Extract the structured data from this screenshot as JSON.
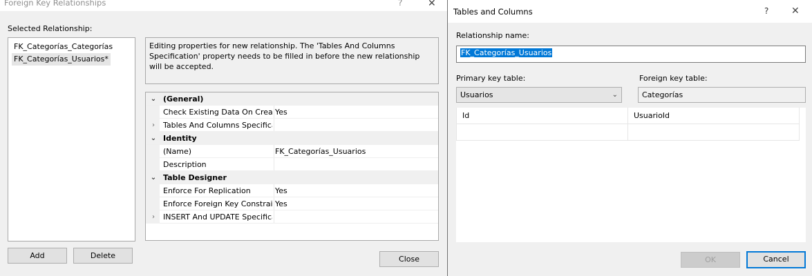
{
  "fk_dialog": {
    "title": "Foreign Key Relationships",
    "help_glyph": "?",
    "close_glyph": "✕",
    "selected_relationship_label": "Selected Relationship:",
    "relationships": [
      "FK_Categorías_Categorías",
      "FK_Categorías_Usuarios*"
    ],
    "info_text": "Editing properties for new relationship.  The 'Tables And Columns Specification' property needs to be filled in before the new relationship will be accepted.",
    "properties": [
      {
        "kind": "category",
        "glyph": "⌄",
        "name": "(General)",
        "value": ""
      },
      {
        "kind": "prop",
        "glyph": "",
        "name": "Check Existing Data On Creat",
        "value": "Yes"
      },
      {
        "kind": "prop",
        "glyph": "›",
        "name": "Tables And Columns Specifica",
        "value": ""
      },
      {
        "kind": "category",
        "glyph": "⌄",
        "name": "Identity",
        "value": ""
      },
      {
        "kind": "prop",
        "glyph": "",
        "name": "(Name)",
        "value": "FK_Categorías_Usuarios"
      },
      {
        "kind": "prop",
        "glyph": "",
        "name": "Description",
        "value": ""
      },
      {
        "kind": "category",
        "glyph": "⌄",
        "name": "Table Designer",
        "value": ""
      },
      {
        "kind": "prop",
        "glyph": "",
        "name": "Enforce For Replication",
        "value": "Yes"
      },
      {
        "kind": "prop",
        "glyph": "",
        "name": "Enforce Foreign Key Constrair",
        "value": "Yes"
      },
      {
        "kind": "prop",
        "glyph": "›",
        "name": "INSERT And UPDATE Specifica",
        "value": ""
      }
    ],
    "add_label": "Add",
    "delete_label": "Delete",
    "close_label": "Close"
  },
  "tc_dialog": {
    "title": "Tables and Columns",
    "help_glyph": "?",
    "close_glyph": "✕",
    "relationship_name_label": "Relationship name:",
    "relationship_name_value": "FK_Categorías_Usuarios",
    "primary_key_table_label": "Primary key table:",
    "primary_key_table_value": "Usuarios",
    "foreign_key_table_label": "Foreign key table:",
    "foreign_key_table_value": "Categorías",
    "columns": [
      {
        "pk": "Id",
        "fk": "UsuarioId"
      },
      {
        "pk": "",
        "fk": ""
      }
    ],
    "ok_label": "OK",
    "cancel_label": "Cancel"
  },
  "colors": {
    "accent": "#0078d7",
    "dialog_bg": "#f0f0f0",
    "border": "#a8a8a8"
  }
}
